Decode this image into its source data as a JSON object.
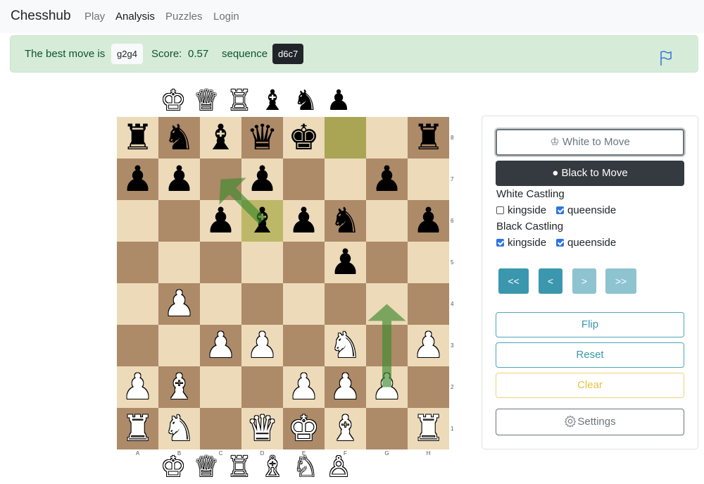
{
  "navbar": {
    "brand": "Chesshub",
    "links": [
      {
        "label": "Play",
        "active": false
      },
      {
        "label": "Analysis",
        "active": true
      },
      {
        "label": "Puzzles",
        "active": false
      },
      {
        "label": "Login",
        "active": false
      }
    ]
  },
  "analysis": {
    "best_move_prefix": "The best move is",
    "best_move": "g2g4",
    "score_label": "Score:",
    "score": "0.57",
    "sequence_label": "sequence",
    "sequence": "d6c7",
    "flag_icon": "flag-icon"
  },
  "captured_top": [
    {
      "piece": "K",
      "color": "white",
      "glyph": "♔"
    },
    {
      "piece": "Q",
      "color": "white",
      "glyph": "♕"
    },
    {
      "piece": "R",
      "color": "white",
      "glyph": "♖"
    },
    {
      "piece": "B",
      "color": "black",
      "glyph": "♝"
    },
    {
      "piece": "N",
      "color": "black",
      "glyph": "♞"
    },
    {
      "piece": "P",
      "color": "black",
      "glyph": "♟"
    }
  ],
  "captured_bottom": [
    {
      "piece": "K",
      "color": "white",
      "glyph": "♔"
    },
    {
      "piece": "Q",
      "color": "white",
      "glyph": "♕"
    },
    {
      "piece": "R",
      "color": "white",
      "glyph": "♖"
    },
    {
      "piece": "B",
      "color": "white",
      "glyph": "♗"
    },
    {
      "piece": "N",
      "color": "white",
      "glyph": "♘"
    },
    {
      "piece": "P",
      "color": "white",
      "glyph": "♙"
    }
  ],
  "board": {
    "ranks": [
      "8",
      "7",
      "6",
      "5",
      "4",
      "3",
      "2",
      "1"
    ],
    "files": [
      "A",
      "B",
      "C",
      "D",
      "E",
      "F",
      "G",
      "H"
    ],
    "colors": {
      "light": "#eddab9",
      "dark": "#ad8a68",
      "highlight": "#a9a554",
      "arrow": "#3f8a2e"
    },
    "highlighted_squares": [
      "f8",
      "d6"
    ],
    "arrows": [
      {
        "from": "d6",
        "to": "c7"
      },
      {
        "from": "g2",
        "to": "g4"
      }
    ],
    "pieces": [
      {
        "square": "a8",
        "color": "b",
        "glyph": "♜"
      },
      {
        "square": "b8",
        "color": "b",
        "glyph": "♞"
      },
      {
        "square": "c8",
        "color": "b",
        "glyph": "♝"
      },
      {
        "square": "d8",
        "color": "b",
        "glyph": "♛"
      },
      {
        "square": "e8",
        "color": "b",
        "glyph": "♚"
      },
      {
        "square": "h8",
        "color": "b",
        "glyph": "♜"
      },
      {
        "square": "a7",
        "color": "b",
        "glyph": "♟"
      },
      {
        "square": "b7",
        "color": "b",
        "glyph": "♟"
      },
      {
        "square": "d7",
        "color": "b",
        "glyph": "♟"
      },
      {
        "square": "g7",
        "color": "b",
        "glyph": "♟"
      },
      {
        "square": "c6",
        "color": "b",
        "glyph": "♟"
      },
      {
        "square": "d6",
        "color": "b",
        "glyph": "♝"
      },
      {
        "square": "e6",
        "color": "b",
        "glyph": "♟"
      },
      {
        "square": "f6",
        "color": "b",
        "glyph": "♞"
      },
      {
        "square": "h6",
        "color": "b",
        "glyph": "♟"
      },
      {
        "square": "f5",
        "color": "b",
        "glyph": "♟"
      },
      {
        "square": "b4",
        "color": "w",
        "glyph": "♟"
      },
      {
        "square": "c3",
        "color": "w",
        "glyph": "♟"
      },
      {
        "square": "d3",
        "color": "w",
        "glyph": "♟"
      },
      {
        "square": "f3",
        "color": "w",
        "glyph": "♞"
      },
      {
        "square": "h3",
        "color": "w",
        "glyph": "♟"
      },
      {
        "square": "a2",
        "color": "w",
        "glyph": "♟"
      },
      {
        "square": "b2",
        "color": "w",
        "glyph": "♝"
      },
      {
        "square": "e2",
        "color": "w",
        "glyph": "♟"
      },
      {
        "square": "f2",
        "color": "w",
        "glyph": "♟"
      },
      {
        "square": "g2",
        "color": "w",
        "glyph": "♟"
      },
      {
        "square": "a1",
        "color": "w",
        "glyph": "♜"
      },
      {
        "square": "b1",
        "color": "w",
        "glyph": "♞"
      },
      {
        "square": "d1",
        "color": "w",
        "glyph": "♛"
      },
      {
        "square": "e1",
        "color": "w",
        "glyph": "♚"
      },
      {
        "square": "f1",
        "color": "w",
        "glyph": "♝"
      },
      {
        "square": "h1",
        "color": "w",
        "glyph": "♜"
      }
    ]
  },
  "panel": {
    "white_to_move": "♔ White to Move",
    "black_to_move": "● Black to Move",
    "white_castling": {
      "title": "White Castling",
      "kingside": {
        "label": "kingside",
        "checked": false
      },
      "queenside": {
        "label": "queenside",
        "checked": true
      }
    },
    "black_castling": {
      "title": "Black Castling",
      "kingside": {
        "label": "kingside",
        "checked": true
      },
      "queenside": {
        "label": "queenside",
        "checked": true
      }
    },
    "nav_buttons": [
      {
        "label": "<<",
        "enabled": true
      },
      {
        "label": "<",
        "enabled": true
      },
      {
        "label": ">",
        "enabled": false
      },
      {
        "label": ">>",
        "enabled": false
      }
    ],
    "flip": "Flip",
    "reset": "Reset",
    "clear": "Clear",
    "settings": "Settings"
  }
}
